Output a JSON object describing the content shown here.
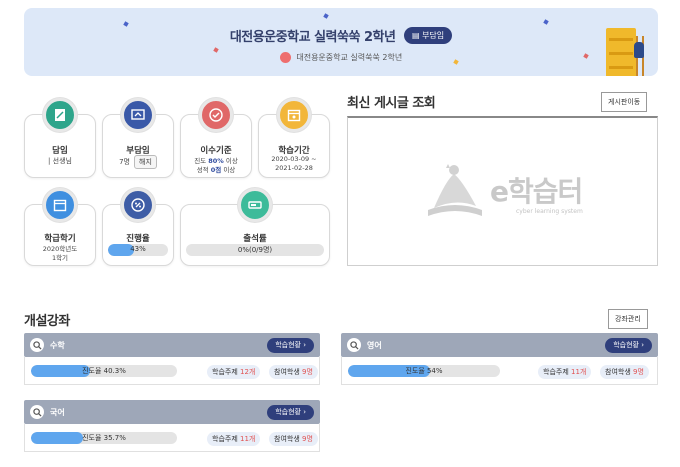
{
  "banner": {
    "title": "대전용운중학교 실력쑥쑥 2학년",
    "role": "부담임",
    "subtitle": "대전용운중학교 실력쑥쑥 2학년"
  },
  "cards": {
    "homeroom": {
      "title": "담임",
      "line1": "| 선생님"
    },
    "sub_homeroom": {
      "title": "부담임",
      "count": "7명",
      "button": "해지"
    },
    "completion": {
      "title": "이수기준",
      "line1_pre": "진도 ",
      "line1_val": "80%",
      "line1_post": " 이상",
      "line2_pre": "성적 ",
      "line2_val": "0점",
      "line2_post": " 이상"
    },
    "period": {
      "title": "학습기간",
      "line1": "2020-03-09 ~",
      "line2": "2021-02-28"
    },
    "semester": {
      "title": "학급학기",
      "line1": "2020학년도",
      "line2": "1학기"
    },
    "progress": {
      "title": "진행율",
      "value_text": "43%",
      "value": 43
    },
    "attendance": {
      "title": "출석률",
      "value_text": "0%(0/9명)",
      "value": 0
    }
  },
  "board": {
    "title": "최신 게시글 조회",
    "move_button": "게시판이동",
    "logo_text": "e학습터",
    "logo_sub": "cyber learning system"
  },
  "courses_section": {
    "title": "개설강좌",
    "manage_button": "강좌관리"
  },
  "courses": [
    {
      "name": "수학",
      "status_btn": "학습현황",
      "progress_text": "진도율 40.3%",
      "progress": 40.3,
      "topics_pre": "학습주제 ",
      "topics_val": "12개",
      "students_pre": "참여학생 ",
      "students_val": "9명"
    },
    {
      "name": "영어",
      "status_btn": "학습현황",
      "progress_text": "진도율 54%",
      "progress": 54,
      "topics_pre": "학습주제 ",
      "topics_val": "11개",
      "students_pre": "참여학생 ",
      "students_val": "9명"
    },
    {
      "name": "국어",
      "status_btn": "학습현황",
      "progress_text": "진도율 35.7%",
      "progress": 35.7,
      "topics_pre": "학습주제 ",
      "topics_val": "11개",
      "students_pre": "참여학생 ",
      "students_val": "9명"
    }
  ],
  "colors": {
    "navy": "#2f3f7c",
    "teal": "#2ea58b",
    "blue": "#3a59a8",
    "red": "#e06868",
    "orange": "#f2b63a",
    "skyblue": "#3f8fe0",
    "grayblue": "#3e5da6",
    "green": "#3dbb9a"
  }
}
